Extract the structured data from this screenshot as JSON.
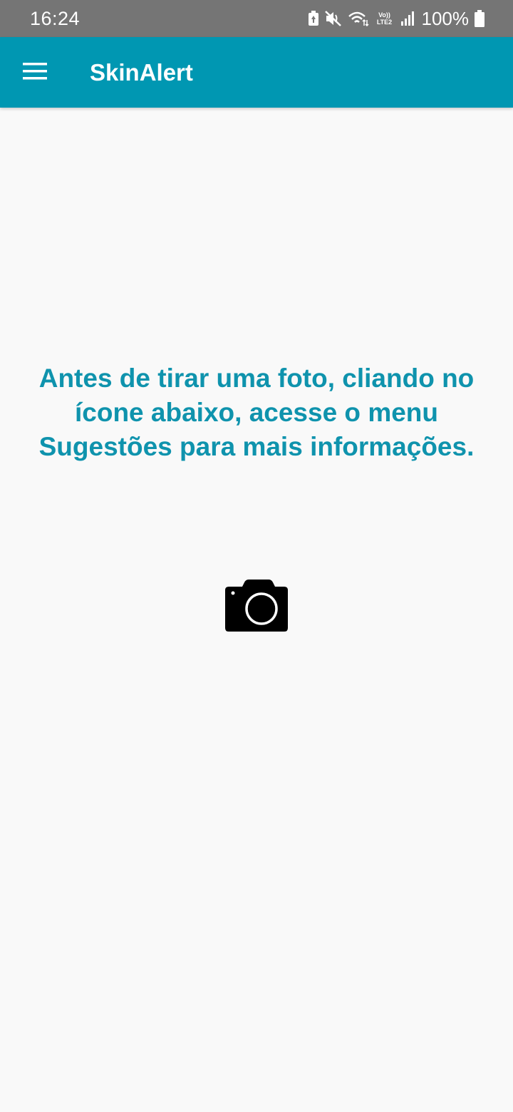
{
  "status_bar": {
    "time": "16:24",
    "battery_percent": "100%",
    "network_label_top": "Vo))",
    "network_label_bottom": "LTE2",
    "icons": [
      "battery-saver-icon",
      "mute-icon",
      "wifi-icon",
      "volte-lte-icon",
      "signal-icon",
      "battery-icon"
    ]
  },
  "app_bar": {
    "title": "SkinAlert",
    "menu_icon": "hamburger-menu-icon",
    "color": "#0097b2"
  },
  "main": {
    "instruction": "Antes de tirar uma foto, cliando no ícone abaixo, acesse o menu Sugestões para mais informações.",
    "instruction_color": "#0f93ad",
    "camera_icon": "camera-icon"
  }
}
